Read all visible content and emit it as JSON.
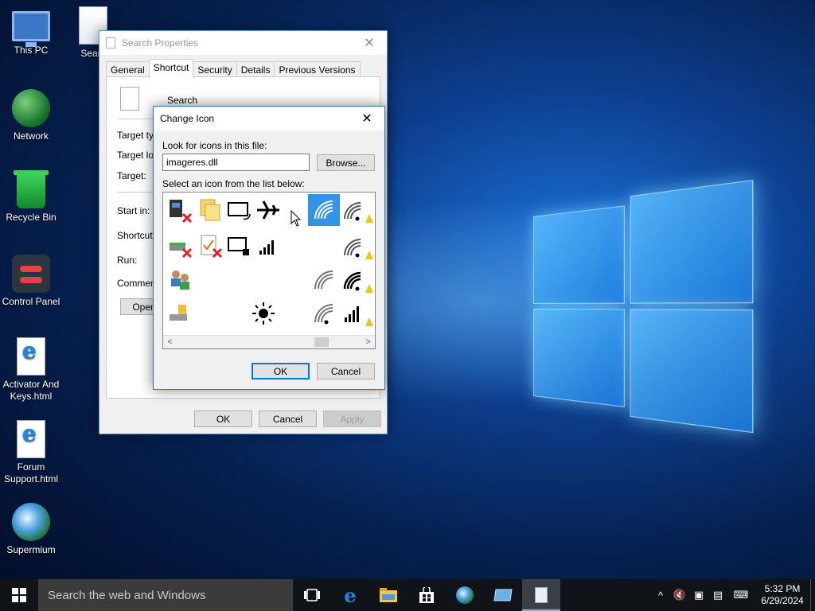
{
  "desktop": {
    "icons": [
      {
        "label": "This PC"
      },
      {
        "label": "Network"
      },
      {
        "label": "Recycle Bin"
      },
      {
        "label": "Control Panel"
      },
      {
        "label": "Activator And Keys.html"
      },
      {
        "label": "Forum Support.html"
      },
      {
        "label": "Supermium"
      },
      {
        "label": "Searc"
      }
    ]
  },
  "properties_window": {
    "title": "Search Properties",
    "tabs": [
      "General",
      "Shortcut",
      "Security",
      "Details",
      "Previous Versions"
    ],
    "active_tab": "Shortcut",
    "shortcut_name": "Search",
    "fields": [
      "Target typ",
      "Target loc",
      "Target:",
      "Start in:",
      "Shortcut k",
      "Run:",
      "Comment:"
    ],
    "open_button": "Open",
    "buttons": {
      "ok": "OK",
      "cancel": "Cancel",
      "apply": "Apply"
    }
  },
  "change_icon_dialog": {
    "title": "Change Icon",
    "look_label": "Look for icons in this file:",
    "file_value": "imageres.dll",
    "browse_button": "Browse...",
    "select_label": "Select an icon from the list below:",
    "ok_button": "OK",
    "cancel_button": "Cancel",
    "selected_icon": "wifi-signal-icon"
  },
  "taskbar": {
    "search_placeholder": "Search the web and Windows",
    "apps": [
      "task-view",
      "edge",
      "file-explorer",
      "store",
      "supermium",
      "control",
      "notepad"
    ],
    "time": "5:32 PM",
    "date": "6/29/2024"
  },
  "colors": {
    "selection": "#3393e8",
    "taskbar": "#101418",
    "dialog_border": "#1979ca"
  }
}
